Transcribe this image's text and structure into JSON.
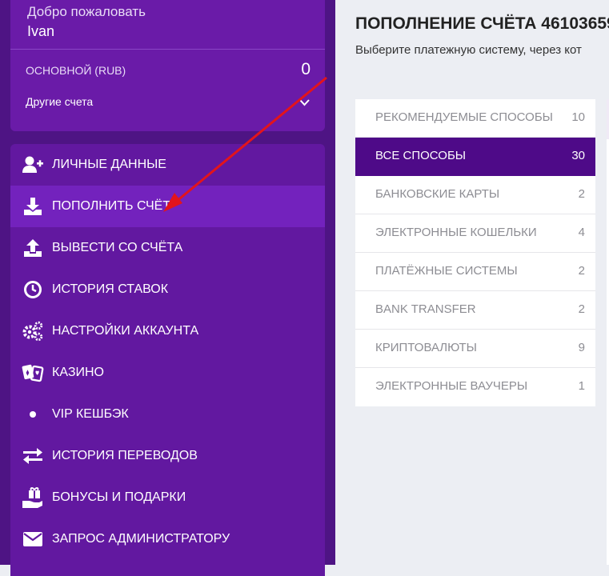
{
  "account": {
    "welcome": "Добро пожаловать",
    "username": "Ivan",
    "balance_label": "ОСНОВНОЙ (RUB)",
    "balance_value": "0",
    "other_accounts": "Другие счета"
  },
  "menu": {
    "items": [
      {
        "label": "ЛИЧНЫЕ ДАННЫЕ",
        "icon": "user-add-icon"
      },
      {
        "label": "ПОПОЛНИТЬ СЧЁТ",
        "icon": "download-icon",
        "active": true
      },
      {
        "label": "ВЫВЕСТИ СО СЧЁТА",
        "icon": "upload-icon"
      },
      {
        "label": "ИСТОРИЯ СТАВОК",
        "icon": "clock-icon"
      },
      {
        "label": "НАСТРОЙКИ АККАУНТА",
        "icon": "gears-icon"
      },
      {
        "label": "КАЗИНО",
        "icon": "cards-icon"
      },
      {
        "label": "VIP КЕШБЭК",
        "icon": "dot-icon"
      },
      {
        "label": "ИСТОРИЯ ПЕРЕВОДОВ",
        "icon": "transfer-arrows-icon"
      },
      {
        "label": "БОНУСЫ И ПОДАРКИ",
        "icon": "gift-hand-icon"
      },
      {
        "label": "ЗАПРОС АДМИНИСТРАТОРУ",
        "icon": "envelope-icon"
      }
    ]
  },
  "main": {
    "title": "ПОПОЛНЕНИЕ СЧЁТА 46103659",
    "subtitle": "Выберите платежную систему, через кот"
  },
  "methods": [
    {
      "label": "РЕКОМЕНДУЕМЫЕ СПОСОБЫ",
      "count": "10"
    },
    {
      "label": "ВСЕ СПОСОБЫ",
      "count": "30",
      "active": true
    },
    {
      "label": "БАНКОВСКИЕ КАРТЫ",
      "count": "2"
    },
    {
      "label": "ЭЛЕКТРОННЫЕ КОШЕЛЬКИ",
      "count": "4"
    },
    {
      "label": "ПЛАТЁЖНЫЕ СИСТЕМЫ",
      "count": "2"
    },
    {
      "label": "BANK TRANSFER",
      "count": "2"
    },
    {
      "label": "КРИПТОВАЛЮТЫ",
      "count": "9"
    },
    {
      "label": "ЭЛЕКТРОННЫЕ ВАУЧЕРЫ",
      "count": "1"
    }
  ],
  "colors": {
    "sidebar": "#4e1484",
    "active_menu": "#7322bd",
    "active_method": "#4e0a88",
    "annotation_arrow": "#e3141b"
  }
}
